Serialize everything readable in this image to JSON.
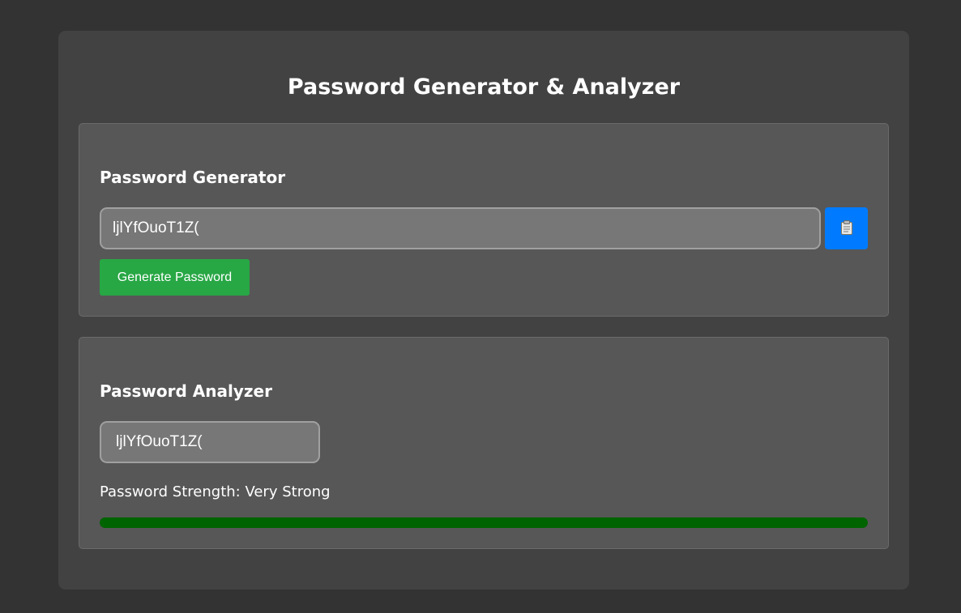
{
  "app": {
    "title": "Password Generator & Analyzer"
  },
  "generator": {
    "heading": "Password Generator",
    "password_value": "ljlYfOuoT1Z(",
    "copy_icon": "clipboard-icon",
    "generate_label": "Generate Password"
  },
  "analyzer": {
    "heading": "Password Analyzer",
    "input_value": "ljlYfOuoT1Z(",
    "strength_text": "Password Strength: Very Strong",
    "strength_level": 1.0,
    "strength_color": "#006400"
  },
  "colors": {
    "copy_button": "#007bff",
    "generate_button": "#28a745"
  }
}
